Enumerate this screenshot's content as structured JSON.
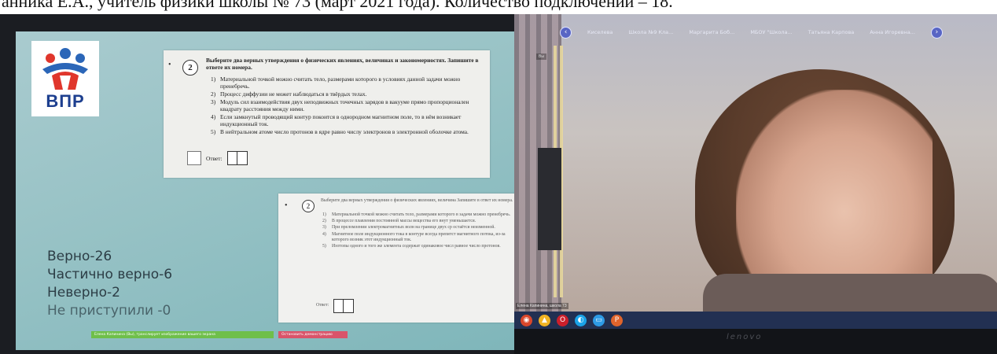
{
  "caption": "анника Е.А., учитель физики школы № 73 (март 2021 года). Количество подключений – 18.",
  "left": {
    "logo_text": "ВПР",
    "question_number": "2",
    "task1": {
      "title": "Выберите два верных утверждения о физических явлениях, величинах и закономерностях. Запишите в ответе их номера.",
      "options": [
        {
          "n": "1)",
          "text": "Материальной точкой можно считать тело, размерами которого в условиях данной задачи можно пренебречь."
        },
        {
          "n": "2)",
          "text": "Процесс диффузии не может наблюдаться в твёрдых телах."
        },
        {
          "n": "3)",
          "text": "Модуль сил взаимодействия двух неподвижных точечных зарядов в вакууме прямо пропорционален квадрату расстояния между ними."
        },
        {
          "n": "4)",
          "text": "Если замкнутый проводящий контур покоится в однородном магнитном поле, то в нём возникает индукционный ток."
        },
        {
          "n": "5)",
          "text": "В нейтральном атоме число протонов в ядре равно числу электронов в электронной оболочке атома."
        }
      ],
      "answer_label": "Ответ:"
    },
    "task2": {
      "title": "Выберите два верных утверждения о физических явлениях, величина Запишите в ответ их номера.",
      "options": [
        {
          "n": "1)",
          "text": "Материальной точкой можно считать тело, размерами которого в задачи можно пренебречь."
        },
        {
          "n": "2)",
          "text": "В процессе плавления постоянной массы вещества его внут уменьшается."
        },
        {
          "n": "3)",
          "text": "При преломлении электромагнитных волн на границе двух ср остаётся неизменной."
        },
        {
          "n": "4)",
          "text": "Магнитное поле индукционного тока в контуре всегда препятст магнитного потока, из-за которого возник этот индукционный ток."
        },
        {
          "n": "5)",
          "text": "Изотопы одного и того же элемента содержат одинаковое числ равное число протонов."
        }
      ],
      "answer_label": "Ответ:"
    },
    "stats": [
      "Верно-26",
      "Частично верно-6",
      "Неверно-2",
      "Не приступили -0"
    ],
    "share_bar": {
      "status": "Елена Капинина (Вы), транслирует изображение вашего экрана",
      "stop": "Остановить демонстрацию"
    }
  },
  "right": {
    "participants": [
      "Киселева",
      "Школа №9 Кла...",
      "Маргарита Боб...",
      "МБОУ \"Школа...",
      "Татьяна Карпова",
      "Анна Игоревна..."
    ],
    "prev_label": "‹",
    "next_label": "›",
    "self_label": "Вы",
    "name_tag": "Елена Капинина, школа 73",
    "taskbar_icons": [
      {
        "glyph": "◉",
        "color": "#d9472b"
      },
      {
        "glyph": "▲",
        "color": "#f0b323"
      },
      {
        "glyph": "O",
        "color": "#cc1f2b"
      },
      {
        "glyph": "◐",
        "color": "#1aa3e8"
      },
      {
        "glyph": "▭",
        "color": "#2e9be6"
      },
      {
        "glyph": "P",
        "color": "#e0642b"
      }
    ],
    "brand": "lenovo"
  }
}
